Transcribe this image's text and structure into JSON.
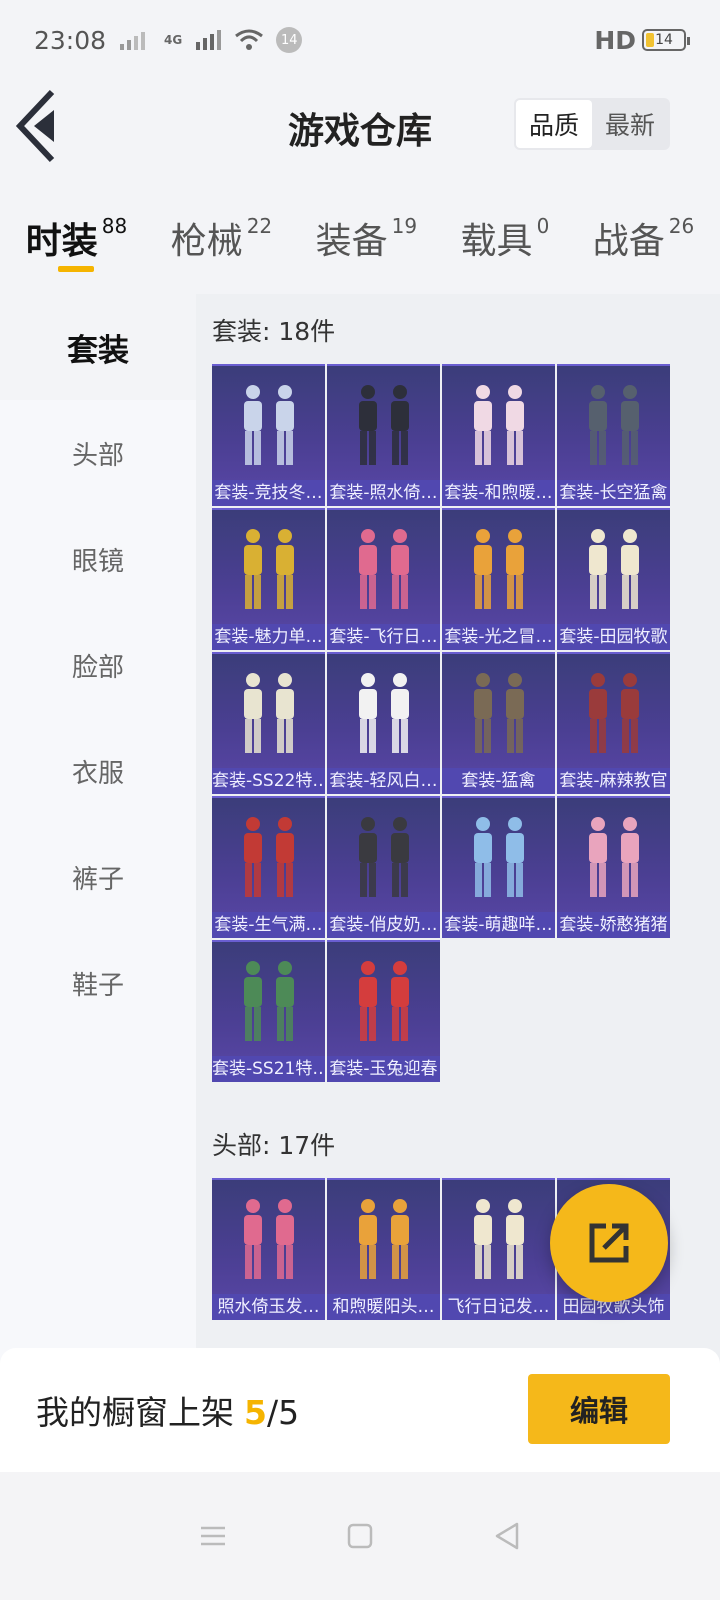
{
  "status_bar": {
    "time": "23:08",
    "net": "4G",
    "notify_count": "14",
    "hd": "HD",
    "battery": "14"
  },
  "header": {
    "title": "游戏仓库",
    "sort": {
      "quality": "品质",
      "newest": "最新"
    }
  },
  "tabs": [
    {
      "label": "时装",
      "count": "88",
      "active": true
    },
    {
      "label": "枪械",
      "count": "22"
    },
    {
      "label": "装备",
      "count": "19"
    },
    {
      "label": "载具",
      "count": "0"
    },
    {
      "label": "战备",
      "count": "26"
    }
  ],
  "sidebar": [
    {
      "label": "套装",
      "active": true
    },
    {
      "label": "头部"
    },
    {
      "label": "眼镜"
    },
    {
      "label": "脸部"
    },
    {
      "label": "衣服"
    },
    {
      "label": "裤子"
    },
    {
      "label": "鞋子"
    }
  ],
  "sections": [
    {
      "title": "套装: 18件",
      "items": [
        "套装-竞技冬…",
        "套装-照水倚…",
        "套装-和煦暖…",
        "套装-长空猛禽",
        "套装-魅力单…",
        "套装-飞行日…",
        "套装-光之冒…",
        "套装-田园牧歌",
        "套装-SS22特…",
        "套装-轻风白…",
        "套装-猛禽",
        "套装-麻辣教官",
        "套装-生气满…",
        "套装-俏皮奶…",
        "套装-萌趣咩…",
        "套装-娇憨猪猪",
        "套装-SS21特…",
        "套装-玉兔迎春"
      ]
    },
    {
      "title": "头部: 17件",
      "items": [
        "照水倚玉发…",
        "和煦暖阳头…",
        "飞行日记发…",
        "田园牧歌头饰"
      ]
    }
  ],
  "footer": {
    "label": "我的橱窗上架",
    "used": "5",
    "sep": "/",
    "total": "5",
    "edit": "编辑"
  },
  "colors": {
    "accent": "#f5b400",
    "card": "#4b3f93"
  }
}
